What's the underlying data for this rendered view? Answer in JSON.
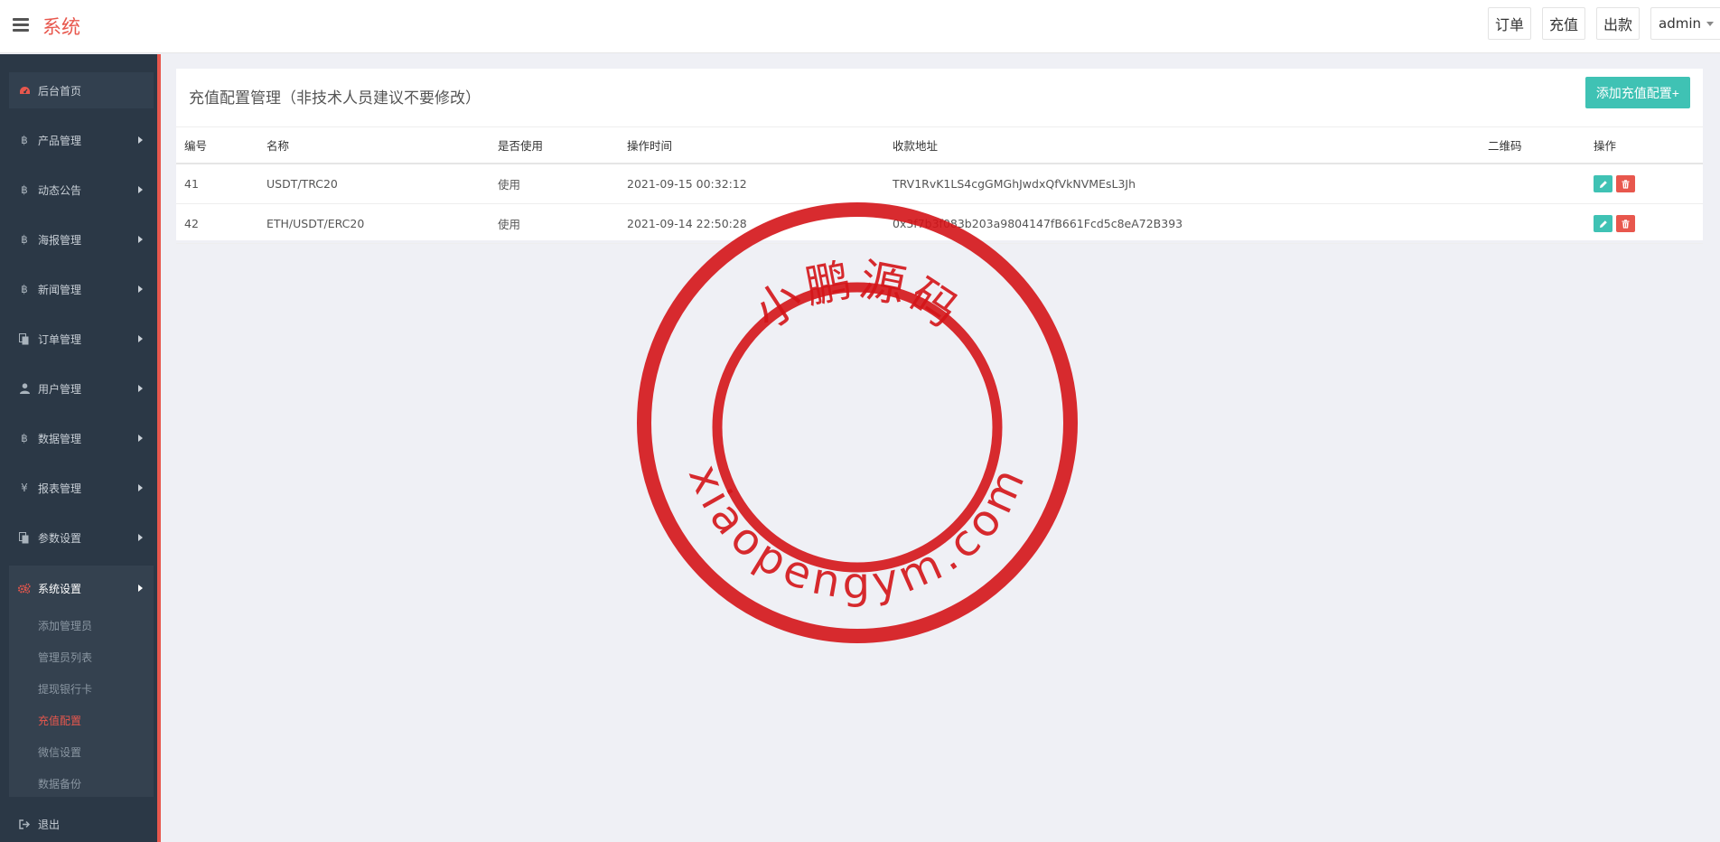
{
  "header": {
    "brand": "系统",
    "actions": [
      "订单",
      "充值",
      "出款"
    ],
    "user": "admin"
  },
  "sidebar": {
    "items": [
      {
        "label": "后台首页",
        "icon": "dashboard-icon"
      },
      {
        "label": "产品管理",
        "icon": "bitcoin-icon"
      },
      {
        "label": "动态公告",
        "icon": "bitcoin-icon"
      },
      {
        "label": "海报管理",
        "icon": "bitcoin-icon"
      },
      {
        "label": "新闻管理",
        "icon": "bitcoin-icon"
      },
      {
        "label": "订单管理",
        "icon": "copy-icon"
      },
      {
        "label": "用户管理",
        "icon": "user-icon"
      },
      {
        "label": "数据管理",
        "icon": "bitcoin-icon"
      },
      {
        "label": "报表管理",
        "icon": "yen-icon"
      },
      {
        "label": "参数设置",
        "icon": "copy-icon"
      }
    ],
    "group": {
      "label": "系统设置",
      "icon": "gears-icon",
      "children": [
        "添加管理员",
        "管理员列表",
        "提现银行卡",
        "充值配置",
        "微信设置",
        "数据备份"
      ],
      "active": "充值配置"
    },
    "logout": "退出"
  },
  "panel": {
    "title": "充值配置管理（非技术人员建议不要修改）",
    "add_button": "添加充值配置+",
    "columns": [
      "编号",
      "名称",
      "是否使用",
      "操作时间",
      "收款地址",
      "二维码",
      "操作"
    ],
    "rows": [
      {
        "id": "41",
        "name": "USDT/TRC20",
        "status": "使用",
        "time": "2021-09-15 00:32:12",
        "address": "TRV1RvK1LS4cgGMGhJwdxQfVkNVMEsL3Jh",
        "qr": ""
      },
      {
        "id": "42",
        "name": "ETH/USDT/ERC20",
        "status": "使用",
        "time": "2021-09-14 22:50:28",
        "address": "0x3f7b3f083b203a9804147fB661Fcd5c8eA72B393",
        "qr": ""
      }
    ]
  },
  "watermark": {
    "top_text": "小鹏源码",
    "bottom_text": "xiaopengym.com",
    "color": "#d41418"
  }
}
